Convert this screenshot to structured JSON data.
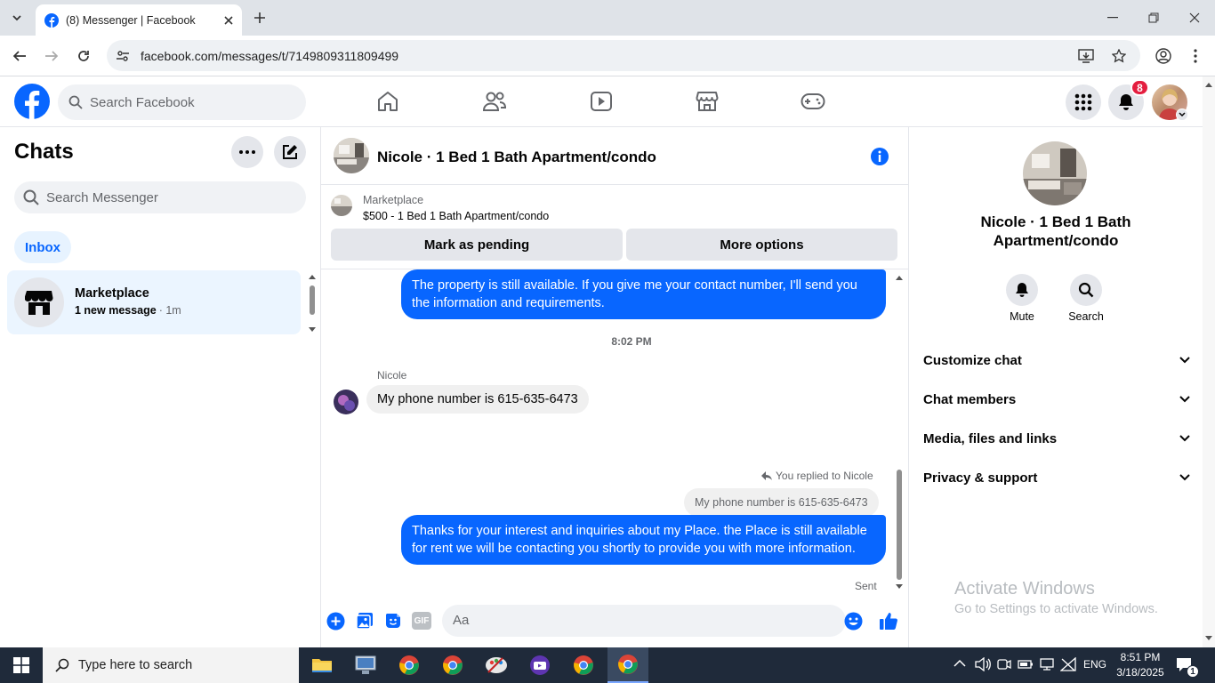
{
  "browser": {
    "tab_title": "(8) Messenger | Facebook",
    "url": "facebook.com/messages/t/7149809311809499"
  },
  "fb": {
    "search_placeholder": "Search Facebook",
    "notif_count": "8"
  },
  "left": {
    "title": "Chats",
    "search_placeholder": "Search Messenger",
    "inbox_label": "Inbox",
    "chat": {
      "name": "Marketplace",
      "preview": "1 new message",
      "time": "· 1m"
    }
  },
  "conversation": {
    "title": "Nicole · 1 Bed 1 Bath Apartment/condo",
    "marketplace_label": "Marketplace",
    "listing": "$500 - 1 Bed 1 Bath Apartment/condo",
    "mark_pending": "Mark as pending",
    "more_options": "More options",
    "messages": {
      "m1": "The property is still available. If you give me your contact number, I'll send you the information and requirements.",
      "time": "8:02 PM",
      "sender": "Nicole",
      "m2": "My phone number is 615-635-6473",
      "replied": "You replied to Nicole",
      "quote": "My phone number is 615-635-6473",
      "m3": "Thanks for your interest and inquiries about my Place. the Place is still available for rent we will be contacting you shortly to provide you with more information.",
      "status": "Sent"
    },
    "composer_placeholder": "Aa",
    "gif_label": "GIF"
  },
  "right": {
    "name": "Nicole · 1 Bed 1 Bath Apartment/condo",
    "mute": "Mute",
    "search": "Search",
    "sections": [
      "Customize chat",
      "Chat members",
      "Media, files and links",
      "Privacy & support"
    ]
  },
  "watermark": {
    "title": "Activate Windows",
    "sub": "Go to Settings to activate Windows."
  },
  "taskbar": {
    "search_placeholder": "Type here to search",
    "lang": "ENG",
    "time": "8:51 PM",
    "date": "3/18/2025",
    "notif": "1"
  },
  "colors": {
    "accent": "#0866ff",
    "bubble_out": "#0866ff",
    "badge": "#e41e3f"
  }
}
